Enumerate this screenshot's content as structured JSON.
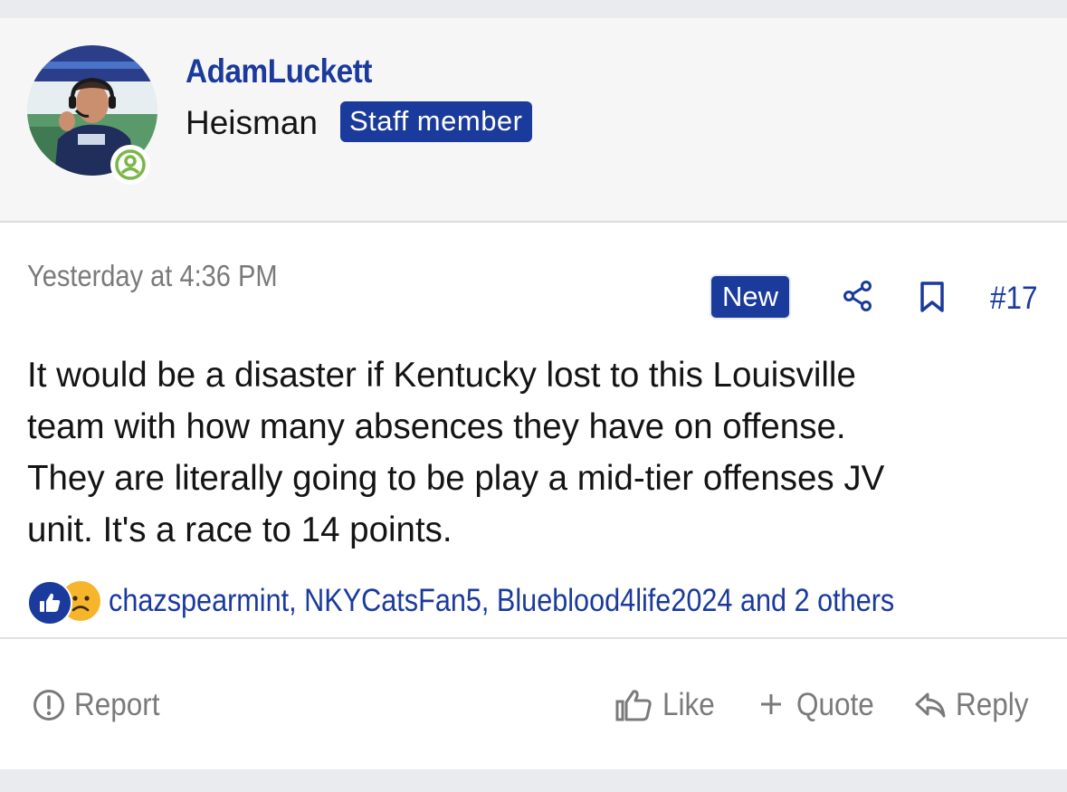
{
  "user": {
    "name": "AdamLuckett",
    "title": "Heisman",
    "badge": "Staff member"
  },
  "post": {
    "date": "Yesterday at 4:36 PM",
    "new_badge": "New",
    "number": "#17",
    "body_lines": [
      "It would be a disaster if Kentucky lost to this Louisville",
      "team with how many absences they have on offense.",
      "They are literally going to be play a mid-tier offenses JV",
      "unit. It's a race to 14 points."
    ],
    "reactors": "chazspearmint, NKYCatsFan5, Blueblood4life2024 and 2 others"
  },
  "actions": {
    "report": "Report",
    "like": "Like",
    "quote": "Quote",
    "reply": "Reply"
  },
  "icons": {
    "avatar": "avatar-photo",
    "online": "online-status-icon",
    "share": "share-icon",
    "bookmark": "bookmark-icon",
    "like_reaction": "thumbs-up-icon",
    "sad_reaction": "sad-face-icon",
    "report": "exclamation-circle-icon",
    "like": "thumbs-up-outline-icon",
    "quote": "plus-icon",
    "reply": "reply-arrow-icon"
  },
  "colors": {
    "accent": "#1a3a9c",
    "muted": "#7a7a7a",
    "online": "#7ab648"
  }
}
